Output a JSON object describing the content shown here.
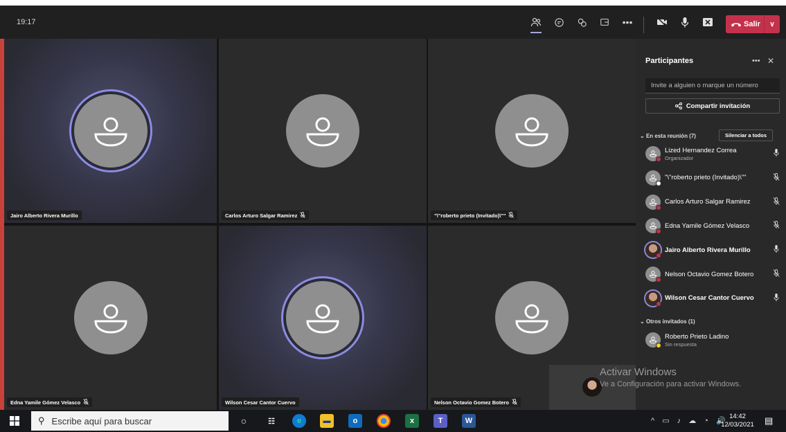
{
  "topbar": {
    "time": "19:17",
    "leave_label": "Salir",
    "icons": [
      "participants-icon",
      "chat-icon",
      "reactions-icon",
      "rooms-icon",
      "more-icon",
      "camera-off-icon",
      "mic-icon",
      "share-icon"
    ]
  },
  "tiles": [
    {
      "name": "Jairo Alberto Rivera Murillo",
      "muted": false,
      "speaking": true
    },
    {
      "name": "Carlos Arturo Salgar Ramirez",
      "muted": true,
      "speaking": false
    },
    {
      "name": "\"\\\"roberto prieto (Invitado)\\\"\"",
      "muted": true,
      "speaking": false
    },
    {
      "name": "Edna Yamile Gómez Velasco",
      "muted": true,
      "speaking": false
    },
    {
      "name": "Wilson Cesar Cantor Cuervo",
      "muted": false,
      "speaking": true
    },
    {
      "name": "Nelson Octavio Gomez Botero",
      "muted": true,
      "speaking": false
    }
  ],
  "panel": {
    "title": "Participantes",
    "invite_placeholder": "Invite a alguien o marque un número",
    "share_label": "Compartir invitación",
    "in_meeting_label": "En esta reunión (7)",
    "mute_all_label": "Silenciar a todos",
    "others_label": "Otros invitados (1)",
    "participants": [
      {
        "name": "Lized Hernandez Correa",
        "sub": "Organizador",
        "mic": "on",
        "status_color": "#c4314b",
        "bold": false
      },
      {
        "name": "\"\\\"roberto prieto (Invitado)\\\"\"",
        "sub": "",
        "mic": "off",
        "status_color": "#ffffff",
        "bold": false
      },
      {
        "name": "Carlos Arturo Salgar Ramirez",
        "sub": "",
        "mic": "off",
        "status_color": "#c4314b",
        "bold": false
      },
      {
        "name": "Edna Yamile Gómez Velasco",
        "sub": "",
        "mic": "off",
        "status_color": "#c4314b",
        "bold": false
      },
      {
        "name": "Jairo Alberto Rivera Murillo",
        "sub": "",
        "mic": "on",
        "status_color": "#c4314b",
        "bold": true
      },
      {
        "name": "Nelson Octavio Gomez Botero",
        "sub": "",
        "mic": "off",
        "status_color": "#c4314b",
        "bold": false
      },
      {
        "name": "Wilson Cesar Cantor Cuervo",
        "sub": "",
        "mic": "on",
        "status_color": "#c4314b",
        "bold": true
      }
    ],
    "others": [
      {
        "name": "Roberto Prieto Ladino",
        "sub": "Sin respuesta",
        "status_color": "#f8d22a"
      }
    ]
  },
  "watermark": {
    "title": "Activar Windows",
    "subtitle": "Ve a Configuración para activar Windows."
  },
  "taskbar": {
    "search_placeholder": "Escribe aquí para buscar",
    "clock_time": "14:42",
    "clock_date": "12/03/2021"
  },
  "colors": {
    "accent": "#8b8ce0",
    "leave": "#c4314b",
    "busy": "#c4314b",
    "away": "#f8d22a"
  }
}
